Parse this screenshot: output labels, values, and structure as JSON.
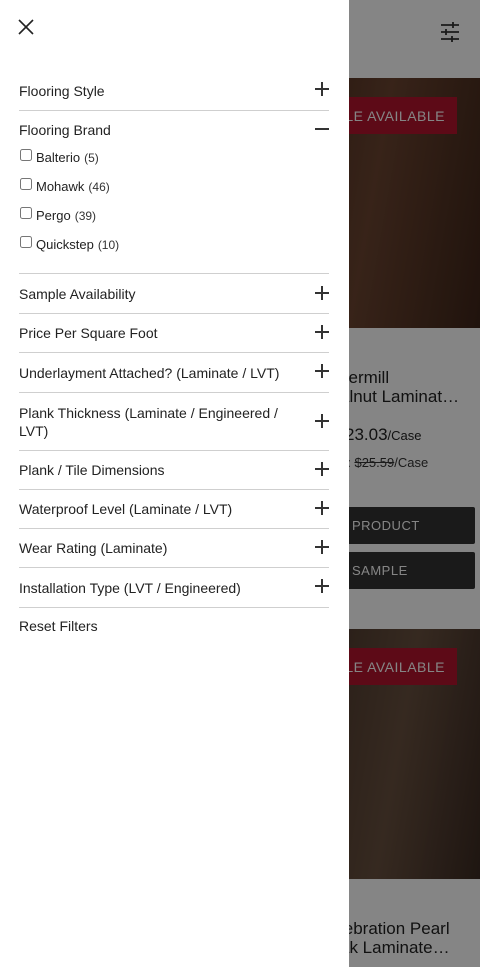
{
  "background": {
    "badge_text": "SAMPLE AVAILABLE",
    "badge_visible_text": "LE AVAILABLE",
    "product1": {
      "title_line1": "vermill",
      "title_line2": "alnut Laminat…",
      "price": "23.03",
      "price_unit": "/Case",
      "was_prefix": "e:",
      "was_price": "$25.59",
      "was_unit": "/Case",
      "button1": "PRODUCT",
      "button2": "SAMPLE"
    },
    "product2": {
      "title_line1": "lebration Pearl",
      "title_line2": "ak Laminate…"
    }
  },
  "drawer": {
    "filters": [
      {
        "label": "Flooring Style",
        "state": "collapsed"
      },
      {
        "label": "Flooring Brand",
        "state": "expanded",
        "options": [
          {
            "name": "Balterio",
            "count": "(5)"
          },
          {
            "name": "Mohawk",
            "count": "(46)"
          },
          {
            "name": "Pergo",
            "count": "(39)"
          },
          {
            "name": "Quickstep",
            "count": "(10)"
          }
        ]
      },
      {
        "label": "Sample Availability",
        "state": "collapsed"
      },
      {
        "label": "Price Per Square Foot",
        "state": "collapsed"
      },
      {
        "label": "Underlayment Attached? (Laminate / LVT)",
        "state": "collapsed"
      },
      {
        "label": "Plank Thickness (Laminate / Engineered / LVT)",
        "state": "collapsed"
      },
      {
        "label": "Plank / Tile Dimensions",
        "state": "collapsed"
      },
      {
        "label": "Waterproof Level (Laminate / LVT)",
        "state": "collapsed"
      },
      {
        "label": "Wear Rating (Laminate)",
        "state": "collapsed"
      },
      {
        "label": "Installation Type (LVT / Engineered)",
        "state": "collapsed"
      }
    ],
    "reset_label": "Reset Filters"
  },
  "colors": {
    "accent": "#b3142c",
    "button_dark": "#333333",
    "divider": "#cfcfcf"
  }
}
